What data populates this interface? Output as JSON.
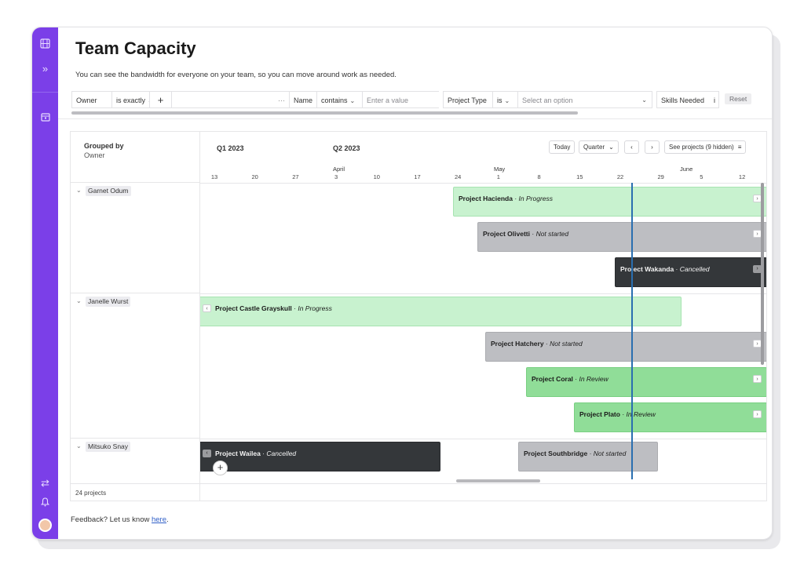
{
  "page": {
    "title": "Team Capacity",
    "subtitle": "You can see the bandwidth for everyone on your team, so you can move around work as needed."
  },
  "sidebar": {
    "icons": [
      "film-icon",
      "chevron-double-right-icon",
      "calendar-icon",
      "swap-icon",
      "bell-icon",
      "avatar"
    ]
  },
  "filters": {
    "owner_label": "Owner",
    "owner_op": "is exactly",
    "add_symbol": "+",
    "more_symbol": "···",
    "name_label": "Name",
    "name_op": "contains",
    "name_placeholder": "Enter a value",
    "type_label": "Project Type",
    "type_op": "is",
    "type_placeholder": "Select an option",
    "skills_label": "Skills Needed",
    "info_symbol": "i",
    "reset_label": "Reset"
  },
  "grid": {
    "grouped_by_label": "Grouped by",
    "grouped_by_value": "Owner",
    "footer_count": "24 projects"
  },
  "timeline": {
    "quarters": [
      "Q1 2023",
      "Q2 2023"
    ],
    "months": [
      "April",
      "May",
      "June"
    ],
    "days": [
      "13",
      "20",
      "27",
      "3",
      "10",
      "17",
      "24",
      "1",
      "8",
      "15",
      "22",
      "29",
      "5",
      "12"
    ],
    "controls": {
      "today": "Today",
      "zoom": "Quarter",
      "prev": "‹",
      "next": "›",
      "see_projects": "See projects (9 hidden)",
      "menu_symbol": "≡"
    }
  },
  "owners": [
    {
      "name": "Garnet Odum",
      "projects": [
        {
          "name": "Project Hacienda",
          "status": "In Progress"
        },
        {
          "name": "Project Olivetti",
          "status": "Not started"
        },
        {
          "name": "Project Wakanda",
          "status": "Cancelled"
        }
      ]
    },
    {
      "name": "Janelle Wurst",
      "projects": [
        {
          "name": "Project Castle Grayskull",
          "status": "In Progress"
        },
        {
          "name": "Project Hatchery",
          "status": "Not started"
        },
        {
          "name": "Project Coral",
          "status": "In Review"
        },
        {
          "name": "Project Plato",
          "status": "In Review"
        }
      ]
    },
    {
      "name": "Mitsuko Snay",
      "projects": [
        {
          "name": "Project Wailea",
          "status": "Cancelled"
        },
        {
          "name": "Project Southbridge",
          "status": "Not started"
        }
      ]
    }
  ],
  "status_colors": {
    "In Progress": "#c8f2cf",
    "In Review": "#90dd98",
    "Not started": "#bdbec2",
    "Cancelled": "#34373a"
  },
  "accent": "#7b3fe8",
  "separator": " · ",
  "feedback": {
    "text": "Feedback? Let us know ",
    "link": "here",
    "period": "."
  }
}
